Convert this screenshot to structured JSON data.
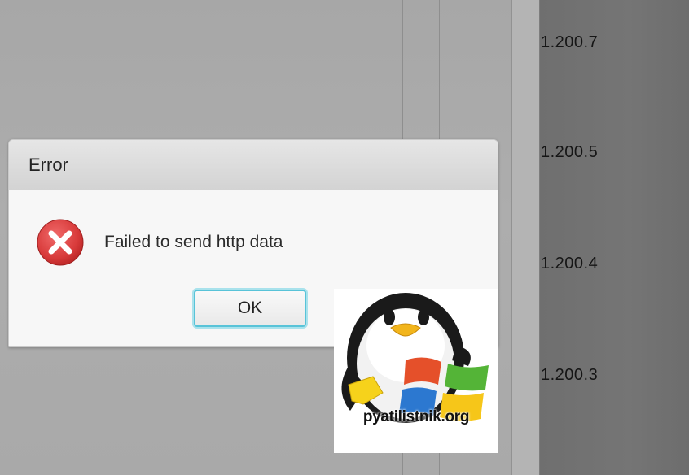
{
  "background": {
    "versions": [
      "1.200.7",
      "1.200.5",
      "1.200.4",
      "1.200.3"
    ]
  },
  "dialog": {
    "title": "Error",
    "icon": "error-x-icon",
    "message": "Failed to send http data",
    "ok_label": "OK"
  },
  "watermark": {
    "text": "pyatilistnik.org",
    "icon": "penguin-windows-logo"
  },
  "colors": {
    "error_red": "#d83a3a",
    "focus_ring": "#58c3d8"
  }
}
